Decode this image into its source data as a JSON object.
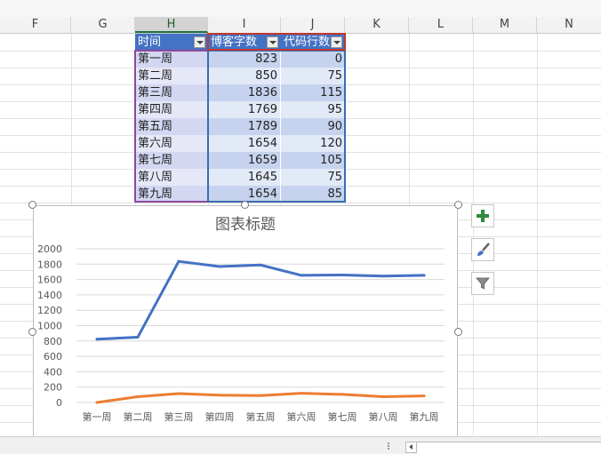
{
  "columns": [
    "F",
    "G",
    "H",
    "I",
    "J",
    "K",
    "L",
    "M",
    "N"
  ],
  "selected_column": "H",
  "table": {
    "headers": [
      "时间",
      "博客字数",
      "代码行数"
    ],
    "rows": [
      [
        "第一周",
        "823",
        "0"
      ],
      [
        "第二周",
        "850",
        "75"
      ],
      [
        "第三周",
        "1836",
        "115"
      ],
      [
        "第四周",
        "1769",
        "95"
      ],
      [
        "第五周",
        "1789",
        "90"
      ],
      [
        "第六周",
        "1654",
        "120"
      ],
      [
        "第七周",
        "1659",
        "105"
      ],
      [
        "第八周",
        "1645",
        "75"
      ],
      [
        "第九周",
        "1654",
        "85"
      ]
    ]
  },
  "chart_data": {
    "type": "line",
    "title": "图表标题",
    "categories": [
      "第一周",
      "第二周",
      "第三周",
      "第四周",
      "第五周",
      "第六周",
      "第七周",
      "第八周",
      "第九周"
    ],
    "series": [
      {
        "name": "博客字数",
        "color": "#4472c4",
        "values": [
          823,
          850,
          1836,
          1769,
          1789,
          1654,
          1659,
          1645,
          1654
        ]
      },
      {
        "name": "代码行数",
        "color": "#ed7d31",
        "values": [
          0,
          75,
          115,
          95,
          90,
          120,
          105,
          75,
          85
        ]
      }
    ],
    "yticks": [
      0,
      200,
      400,
      600,
      800,
      1000,
      1200,
      1400,
      1600,
      1800,
      2000
    ],
    "ylim": [
      0,
      2000
    ],
    "grid": true
  },
  "chart_tools": [
    "plus-icon",
    "brush-icon",
    "filter-icon"
  ]
}
